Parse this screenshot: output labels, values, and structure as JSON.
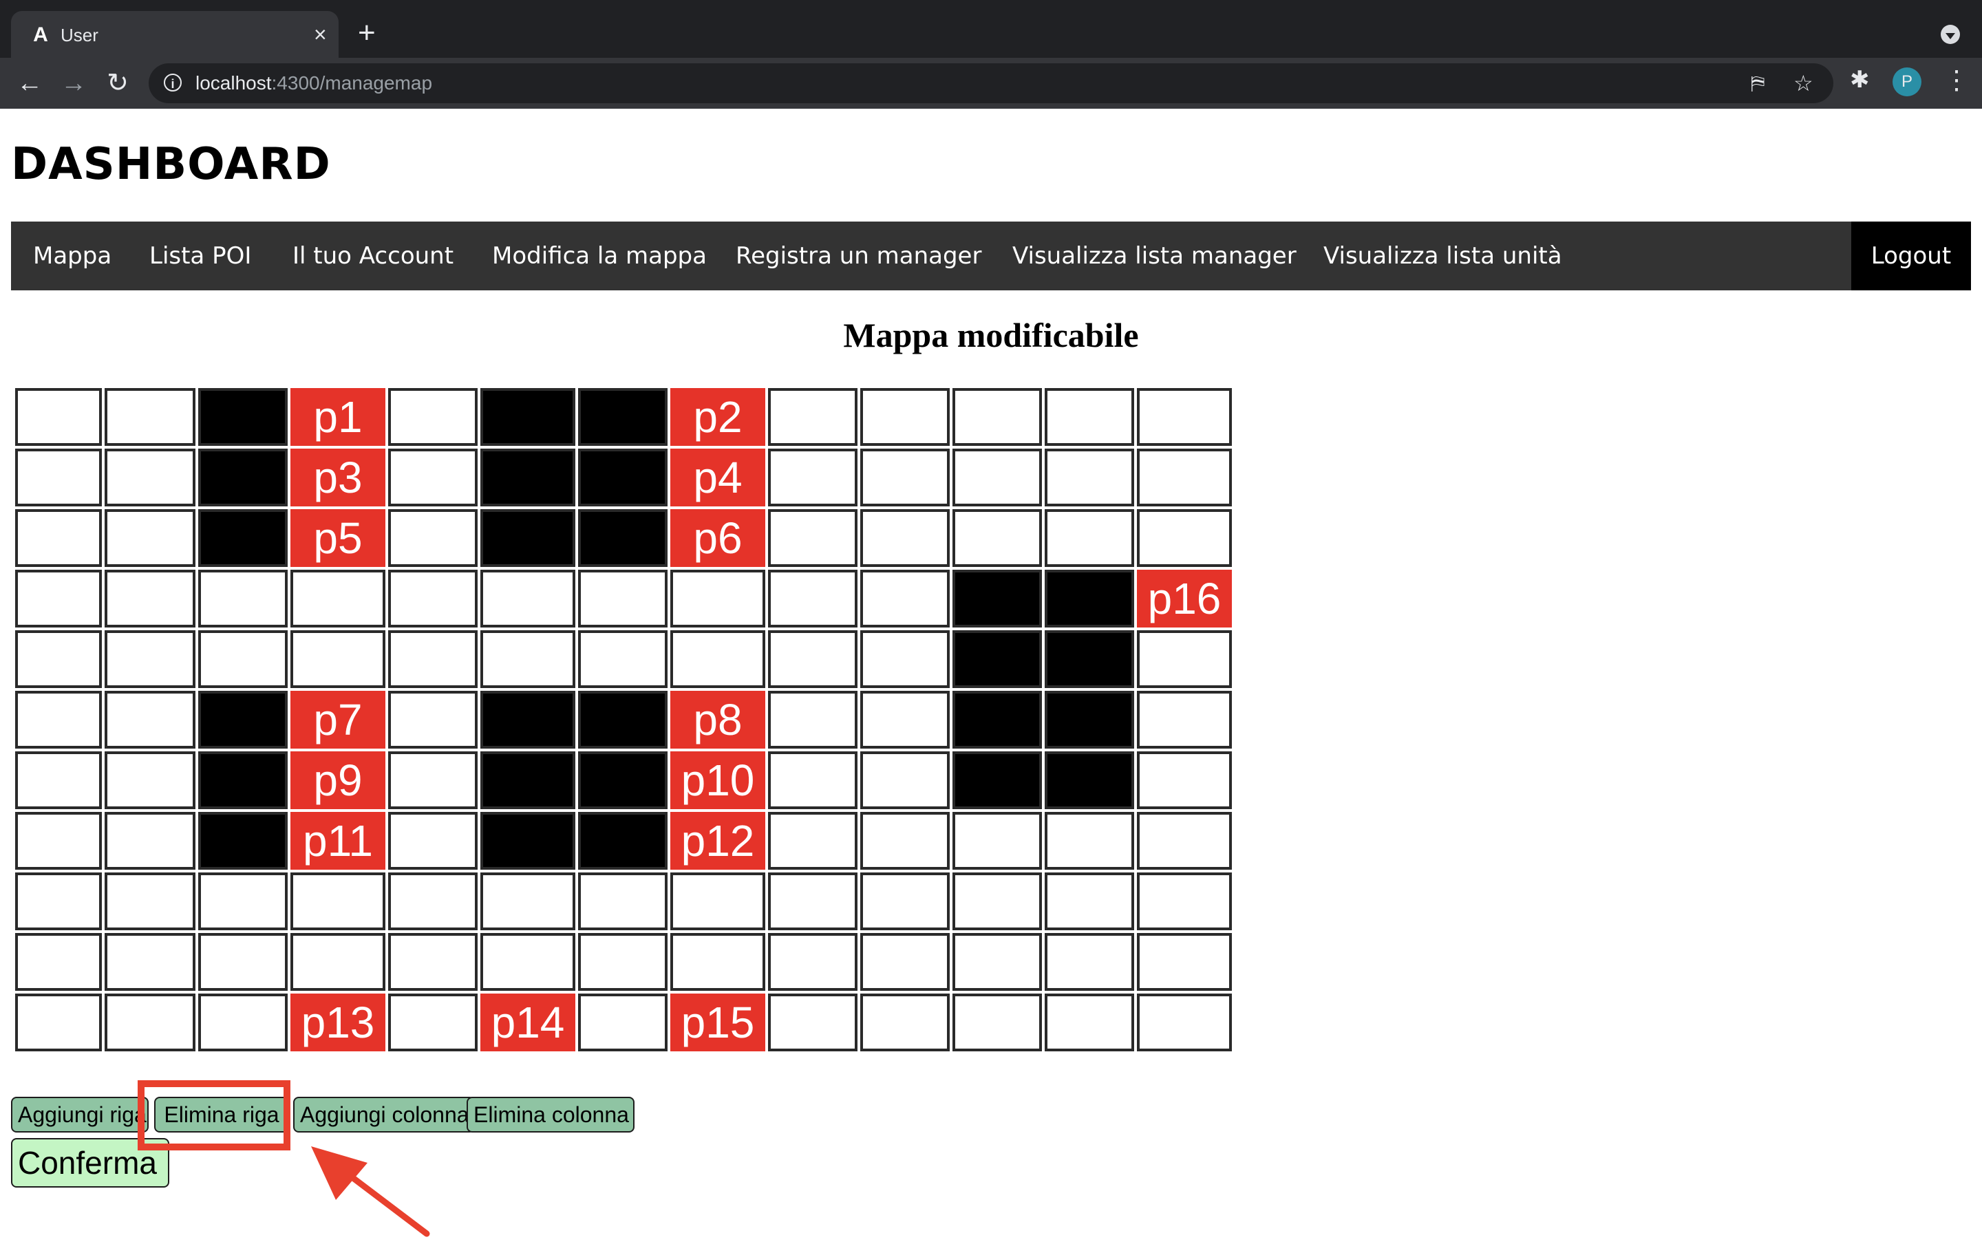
{
  "browser": {
    "tab_title": "User",
    "tab_favicon": "A",
    "tab_close": "×",
    "new_tab": "+",
    "url_host": "localhost",
    "url_path": ":4300/managemap",
    "profile_initial": "P"
  },
  "page": {
    "title": "DASHBOARD",
    "nav": [
      "Mappa",
      "Lista POI",
      "Il tuo Account",
      "Modifica la mappa",
      "Registra un manager",
      "Visualizza lista manager",
      "Visualizza lista unità"
    ],
    "logout": "Logout",
    "map_title": "Mappa modificabile"
  },
  "map": {
    "columns": 13,
    "legend": {
      "empty": "e",
      "wall": "w",
      "poi": "poi label"
    },
    "rows": [
      [
        "e",
        "e",
        "w",
        "p1",
        "e",
        "w",
        "w",
        "p2",
        "e",
        "e",
        "e",
        "e",
        "e"
      ],
      [
        "e",
        "e",
        "w",
        "p3",
        "e",
        "w",
        "w",
        "p4",
        "e",
        "e",
        "e",
        "e",
        "e"
      ],
      [
        "e",
        "e",
        "w",
        "p5",
        "e",
        "w",
        "w",
        "p6",
        "e",
        "e",
        "e",
        "e",
        "e"
      ],
      [
        "e",
        "e",
        "e",
        "e",
        "e",
        "e",
        "e",
        "e",
        "e",
        "e",
        "w",
        "w",
        "p16"
      ],
      [
        "e",
        "e",
        "e",
        "e",
        "e",
        "e",
        "e",
        "e",
        "e",
        "e",
        "w",
        "w",
        "e"
      ],
      [
        "e",
        "e",
        "w",
        "p7",
        "e",
        "w",
        "w",
        "p8",
        "e",
        "e",
        "w",
        "w",
        "e"
      ],
      [
        "e",
        "e",
        "w",
        "p9",
        "e",
        "w",
        "w",
        "p10",
        "e",
        "e",
        "w",
        "w",
        "e"
      ],
      [
        "e",
        "e",
        "w",
        "p11",
        "e",
        "w",
        "w",
        "p12",
        "e",
        "e",
        "e",
        "e",
        "e"
      ],
      [
        "e",
        "e",
        "e",
        "e",
        "e",
        "e",
        "e",
        "e",
        "e",
        "e",
        "e",
        "e",
        "e"
      ],
      [
        "e",
        "e",
        "e",
        "e",
        "e",
        "e",
        "e",
        "e",
        "e",
        "e",
        "e",
        "e",
        "e"
      ],
      [
        "e",
        "e",
        "e",
        "p13",
        "e",
        "p14",
        "e",
        "p15",
        "e",
        "e",
        "e",
        "e",
        "e"
      ]
    ]
  },
  "controls": {
    "add_row": "Aggiungi riga",
    "delete_row": "Elimina riga",
    "add_column": "Aggiungi colonna",
    "delete_column": "Elimina colonna",
    "confirm": "Conferma"
  },
  "colors": {
    "poi": "#e53329",
    "wall": "#000000",
    "empty": "#ffffff",
    "nav_bg": "#333333",
    "control_button": "#8fc4a3",
    "confirm_button": "#c4f5c4",
    "annotation": "#e8402d"
  },
  "icons": [
    "back-icon",
    "forward-icon",
    "reload-icon",
    "info-icon",
    "translate-icon",
    "star-icon",
    "extensions-icon",
    "menu-icon",
    "tab-search-icon"
  ]
}
